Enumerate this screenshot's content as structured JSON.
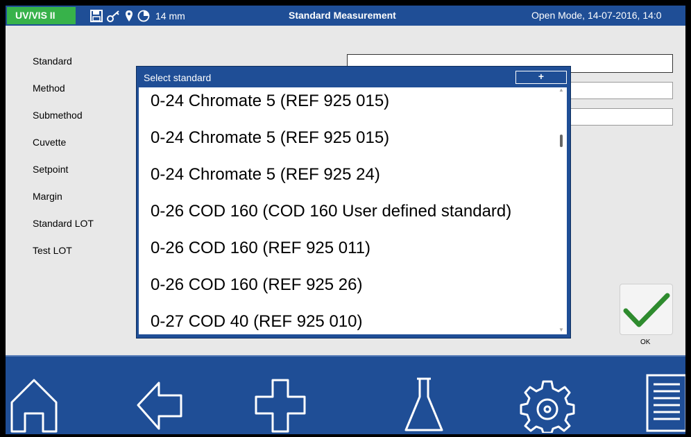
{
  "topbar": {
    "device": "UV/VIS II",
    "icons": [
      "save-icon",
      "key-icon",
      "location-pin-icon",
      "cuvette-circle-icon"
    ],
    "cuvette_size": "14 mm",
    "title": "Standard Measurement",
    "mode": "Open Mode, 14-07-2016, 14:0"
  },
  "form": {
    "labels": [
      "Standard",
      "Method",
      "Submethod",
      "Cuvette",
      "Setpoint",
      "Margin",
      "Standard LOT",
      "Test LOT"
    ]
  },
  "modal": {
    "title": "Select standard",
    "add_label": "+",
    "items": [
      "0-24 Chromate 5 (REF 925 015)",
      "0-24 Chromate 5 (REF 925 015)",
      "0-24 Chromate 5 (REF 925 24)",
      "0-26 COD 160 (COD 160 User defined standard)",
      "0-26 COD 160 (REF 925 011)",
      "0-26 COD 160 (REF 925 26)",
      "0-27 COD 40 (REF 925 010)"
    ]
  },
  "ok": {
    "label": "OK",
    "icon": "checkmark-icon"
  },
  "nav": {
    "icons": [
      "home-icon",
      "back-arrow-icon",
      "plus-icon",
      "flask-icon",
      "gear-icon",
      "menu-list-icon"
    ]
  },
  "colors": {
    "primary_blue": "#1f4e96",
    "device_green": "#37b24a",
    "check_green": "#2e8b2e",
    "background": "#e8e8e8"
  }
}
